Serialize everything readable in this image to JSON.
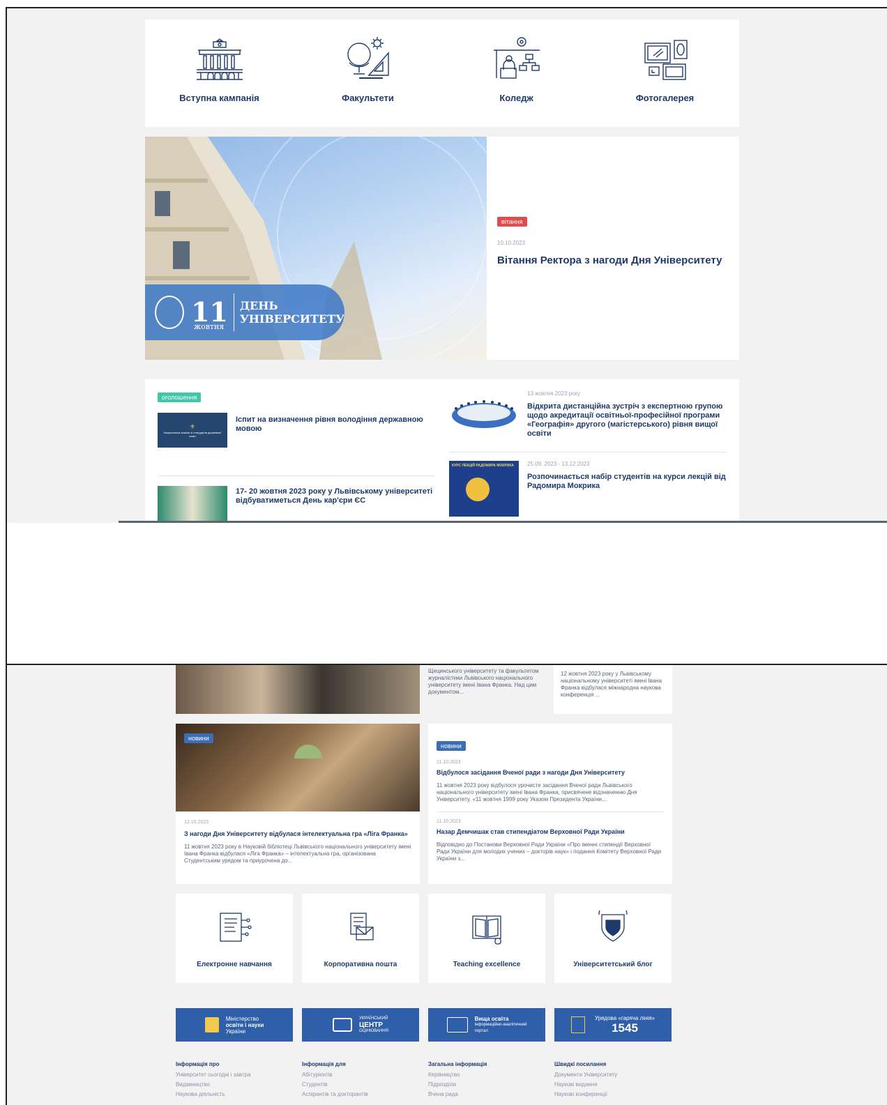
{
  "quick_links": [
    {
      "label": "Вступна кампанія",
      "icon": "university-building-icon"
    },
    {
      "label": "Факультети",
      "icon": "globe-ruler-icon"
    },
    {
      "label": "Коледж",
      "icon": "teacher-org-chart-icon"
    },
    {
      "label": "Фотогалерея",
      "icon": "picture-frames-icon"
    }
  ],
  "hero": {
    "badge_number": "11",
    "badge_month": "жовтня",
    "badge_title_1": "ДЕНЬ",
    "badge_title_2": "УНІВЕРСИТЕТУ",
    "tag": "вітання",
    "date": "10.10.2023",
    "title": "Вітання Ректора з нагоди Дня Університету"
  },
  "announcements": {
    "tag": "оголошення",
    "items": [
      {
        "title": "Іспит на визначення рівня володіння державною мовою",
        "thumb_text": "Національна комісія зі стандартів державної мови"
      },
      {
        "title": "17- 20 жовтня 2023 року у Львівському університеті відбуватиметься День кар'єри ЄС"
      }
    ],
    "right_items": [
      {
        "date": "13 жовтня 2023 року",
        "title": "Відкрита дистанційна зустріч з експертною групою щодо акредитації освітньої-професійної програми «Географія» другого (магістерського) рівня вищої освіти"
      },
      {
        "date": "25.09. 2023 - 13.12.2023",
        "title": "Розпочинається набір студентів на курси лекцій від Радомира Мокрика",
        "thumb_text": "КУРС ЛЕКЦІЙ РАДОМИРА МОКРИКА"
      }
    ]
  },
  "bottom": {
    "partial_text_1": "Щецинського університету та факультетом журналістики Львівського національного університету імені Івана Франка. Над цим документом...",
    "partial_text_2": "12 жовтня 2023 року у Львівському національному університеті імені Івана Франка відбулася міжнародна наукова конференція ...",
    "feature": {
      "tag": "новини",
      "date": "12.10.2023",
      "title": "З нагоди Дня Університету відбулася інтелектуальна гра «Ліга Франка»",
      "excerpt": "11 жовтня 2023 року в Науковій бібліотеці Львівського національного університету імені Івана Франка відбулася «Ліга Франка» – інтелектуальна гра, організована Студентським урядом та приурочена до..."
    },
    "news_list": {
      "tag": "новини",
      "items": [
        {
          "date": "11.10.2023",
          "title": "Відбулося засідання Вченої ради з нагоди Дня Університету",
          "excerpt": "11 жовтня 2023 року відбулося урочисте засідання Вченої ради Львівського національного університету імені Івана Франка, присвячене відзначенню Дня Університету. «11 жовтня 1999 року Указом Президента України..."
        },
        {
          "date": "11.10.2023",
          "title": "Назар Демчишак став стипендіатом Верховної Ради України",
          "excerpt": "Відповідно до Постанови Верховної Ради України «Про іменні стипендії Верховної Ради України для молодих учених – докторів наук» і подання Комітету Верховної Ради України з..."
        }
      ]
    },
    "services": [
      {
        "label": "Електронне навчання",
        "icon": "e-learning-icon"
      },
      {
        "label": "Корпоративна пошта",
        "icon": "mail-document-icon"
      },
      {
        "label": "Teaching excellence",
        "icon": "book-icon"
      },
      {
        "label": "Університетський блог",
        "icon": "university-crest-icon"
      }
    ],
    "banners": [
      {
        "line1": "Міністерство",
        "line2": "освіти і науки",
        "line3": "України"
      },
      {
        "line1": "УКРАЇНСЬКИЙ",
        "line2": "ЦЕНТР",
        "line3": "ОЦІНЮВАННЯ"
      },
      {
        "line1": "Вища освіта",
        "line2": "Інформаційно-аналітичний",
        "line3": "портал"
      },
      {
        "line1": "Урядова «гаряча лінія»",
        "line2": "1545"
      }
    ],
    "footer": [
      {
        "heading": "Інформація про",
        "links": [
          "Університет сьогодні і завтра",
          "Видавництво",
          "Наукова діяльність"
        ]
      },
      {
        "heading": "Інформація для",
        "links": [
          "Абітурієнтів",
          "Студентів",
          "Аспірантів та докторантів"
        ]
      },
      {
        "heading": "Загальна інформація",
        "links": [
          "Керівництво",
          "Підрозділи",
          "Вчена рада"
        ]
      },
      {
        "heading": "Швидкі посилання",
        "links": [
          "Документи Університету",
          "Наукові видання",
          "Наукові конференції"
        ]
      }
    ]
  },
  "colors": {
    "brand": "#1d3a6b",
    "tag_red": "#e24b4b",
    "tag_green": "#3fc7a8",
    "tag_blue": "#3d6db5",
    "banner": "#2f5fa8"
  }
}
